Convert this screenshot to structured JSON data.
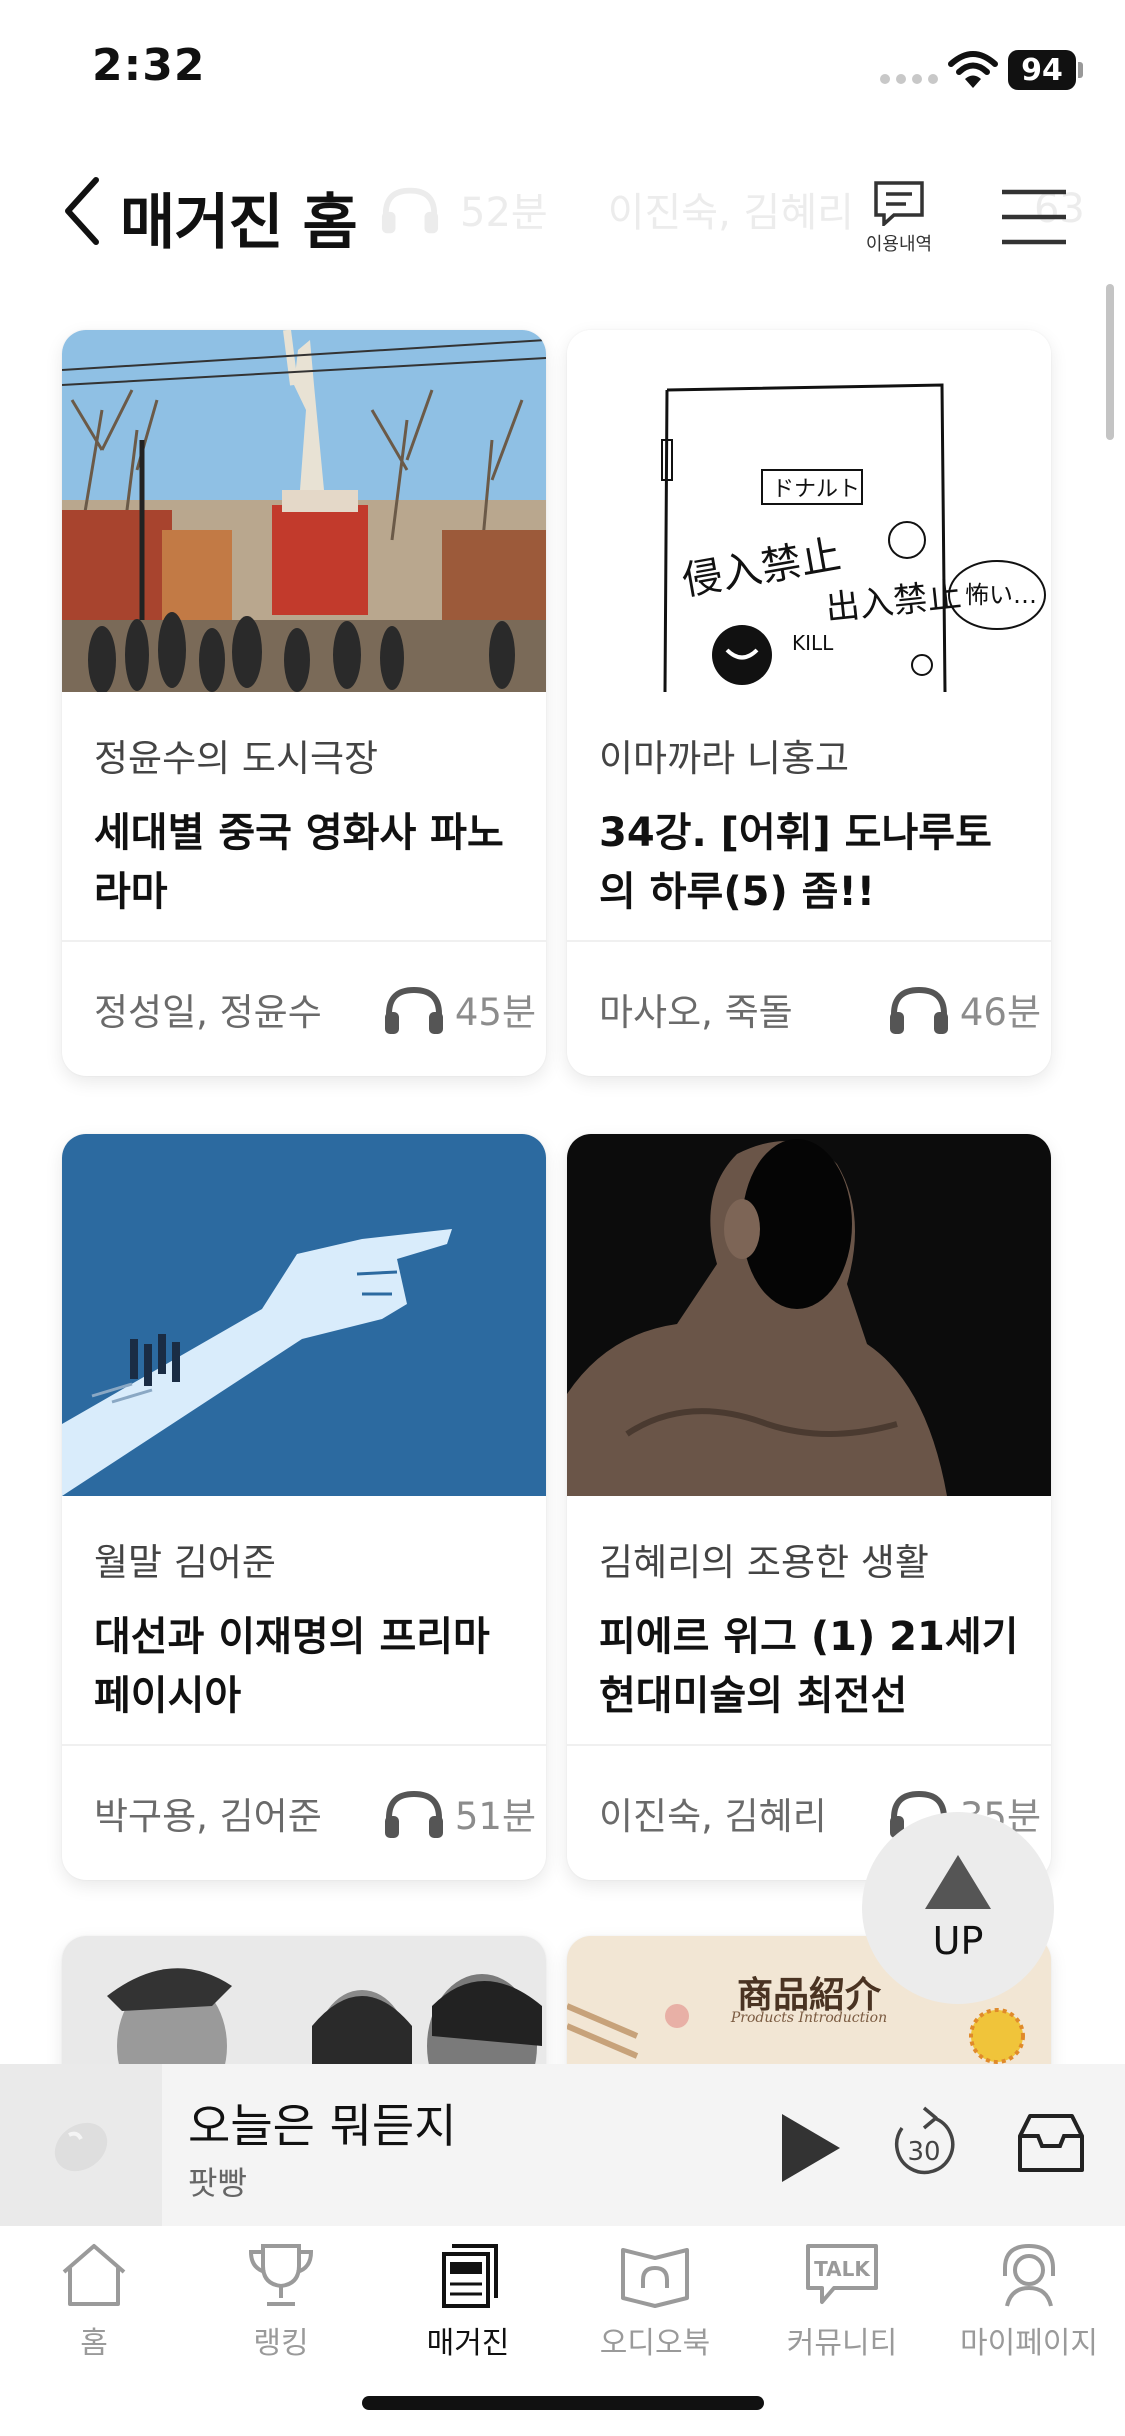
{
  "status_bar": {
    "time": "2:32",
    "battery": "94"
  },
  "header": {
    "title": "매거진 홈",
    "history_label": "이용내역",
    "behind_text": {
      "duration": "52분",
      "authors": "이진숙, 김혜리",
      "tail": "63"
    }
  },
  "cards": [
    {
      "series": "정윤수의 도시극장",
      "title": "세대별 중국 영화사 파노라마",
      "authors": "정성일, 정윤수",
      "duration": "45분",
      "image": "statue-square-photo"
    },
    {
      "series": "이마까라 니홍고",
      "title": "34강. [어휘] 도나루토의 하루(5) 좀!!",
      "authors": "마사오, 죽돌",
      "duration": "46분",
      "image": "door-doodle-illustration"
    },
    {
      "series": "월말 김어준",
      "title": "대선과 이재명의 프리마 페이시아",
      "authors": "박구용, 김어준",
      "duration": "51분",
      "image": "pointing-hand-illustration"
    },
    {
      "series": "김혜리의 조용한 생활",
      "title": "피에르 위그 (1) 21세기 현대미술의 최전선",
      "authors": "이진숙, 김혜리",
      "duration": "35분",
      "image": "dark-figure-photo"
    }
  ],
  "partial_cards": [
    {
      "image": "bw-portrait-photo"
    },
    {
      "image": "product-intro-poster",
      "poster_title": "商品紹介",
      "poster_sub": "Products Introduction"
    }
  ],
  "up_button": {
    "label": "UP"
  },
  "mini_player": {
    "title": "오늘은 뭐듣지",
    "subtitle": "팟빵",
    "skip_seconds": "30"
  },
  "tab_bar": {
    "tabs": [
      {
        "label": "홈",
        "icon": "house-icon",
        "active": false
      },
      {
        "label": "랭킹",
        "icon": "trophy-icon",
        "active": false
      },
      {
        "label": "매거진",
        "icon": "magazine-icon",
        "active": true
      },
      {
        "label": "오디오북",
        "icon": "audiobook-icon",
        "active": false
      },
      {
        "label": "커뮤니티",
        "icon": "talk-bubble-icon",
        "active": false
      },
      {
        "label": "마이페이지",
        "icon": "profile-headphones-icon",
        "active": false
      }
    ],
    "talk_badge": "TALK"
  },
  "colors": {
    "accent_blue": "#2c6aa0",
    "text_primary": "#111111",
    "text_secondary": "#8c8c8c"
  }
}
